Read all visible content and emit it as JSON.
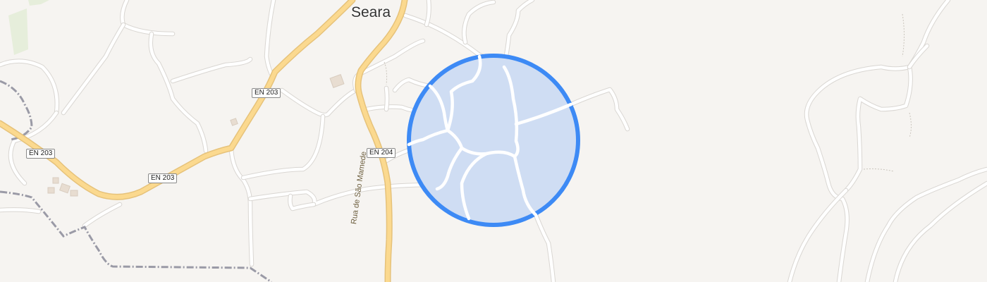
{
  "map": {
    "place_label": "Seara",
    "road_labels": {
      "en203_a": "EN 203",
      "en203_b": "EN 203",
      "en203_c": "EN 203",
      "en204": "EN 204"
    },
    "street_label": "Rua de São Mamede",
    "location_accuracy_circle": {
      "fill_color": "#cfddf3",
      "stroke_color": "#3d8af5"
    },
    "colors": {
      "background": "#f6f4f1",
      "major_road": "#fbd98f",
      "minor_road": "#ffffff",
      "railway": "#9a9aa6"
    }
  }
}
